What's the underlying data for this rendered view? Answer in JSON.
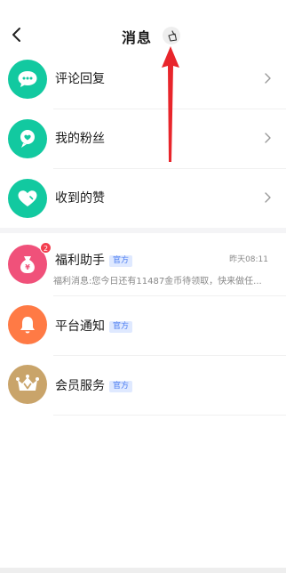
{
  "header": {
    "title": "消息",
    "back_icon": "chevron-left-icon",
    "clear_icon": "broom-icon"
  },
  "interactions": {
    "items": [
      {
        "label": "评论回复",
        "icon": "comment-bubble-icon",
        "color": "#12c9a0"
      },
      {
        "label": "我的粉丝",
        "icon": "fan-heart-icon",
        "color": "#12c9a0"
      },
      {
        "label": "收到的赞",
        "icon": "heart-icon",
        "color": "#12c9a0"
      }
    ]
  },
  "messages": [
    {
      "title": "福利助手",
      "official_tag": "官方",
      "time": "昨天08:11",
      "preview": "福利消息:您今日还有11487金币待领取，快来做任...",
      "badge": "2",
      "icon": "money-bag-icon",
      "color": "#f0517a"
    },
    {
      "title": "平台通知",
      "official_tag": "官方",
      "icon": "bell-icon",
      "color": "#ff7a45"
    },
    {
      "title": "会员服务",
      "official_tag": "官方",
      "icon": "crown-icon",
      "color": "#c9a46a"
    }
  ],
  "annotation": {
    "arrow_color": "#e8252b"
  }
}
